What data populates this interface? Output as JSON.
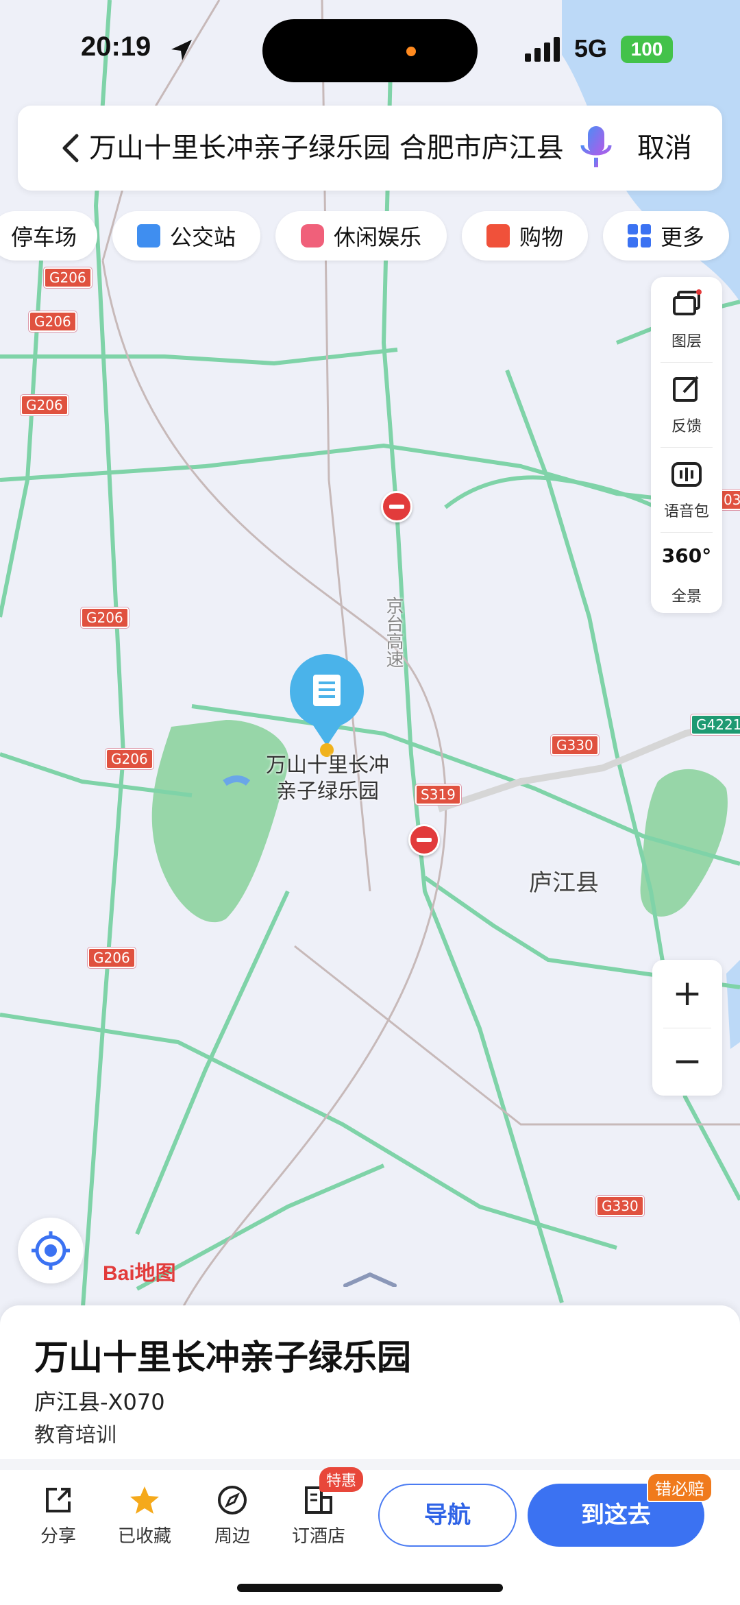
{
  "status": {
    "time": "20:19",
    "network": "5G",
    "battery": "100"
  },
  "search": {
    "query": "万山十里长冲亲子绿乐园 合肥市庐江县",
    "cancel_label": "取消"
  },
  "chips": [
    {
      "label": "停车场"
    },
    {
      "label": "公交站"
    },
    {
      "label": "休闲娱乐"
    },
    {
      "label": "购物"
    },
    {
      "label": "更多"
    }
  ],
  "tools": {
    "layers": "图层",
    "feedback": "反馈",
    "voice_pack": "语音包",
    "panorama": "全景",
    "panorama_icon": "360°"
  },
  "zoom": {
    "in": "+",
    "out": "−"
  },
  "map": {
    "roads": [
      "G206",
      "G206",
      "G206",
      "G206",
      "G206",
      "G206",
      "G330",
      "G330",
      "S319",
      "G4221",
      "03"
    ],
    "expressway": "京台高速",
    "county": "庐江县",
    "marker_label": "万山十里长冲亲子绿乐园",
    "brand": "Bai地图"
  },
  "poi": {
    "name": "万山十里长冲亲子绿乐园",
    "address": "庐江县-X070",
    "category": "教育培训"
  },
  "actions": {
    "share": "分享",
    "saved": "已收藏",
    "nearby": "周边",
    "hotel": "订酒店",
    "hotel_badge": "特惠"
  },
  "buttons": {
    "navigate": "导航",
    "go_here": "到这去",
    "go_badge": "错必赔"
  },
  "colors": {
    "accent": "#3b72f2",
    "road_green": "#7fd3a8",
    "marker": "#4ab3ea",
    "shield": "#e0513f"
  }
}
